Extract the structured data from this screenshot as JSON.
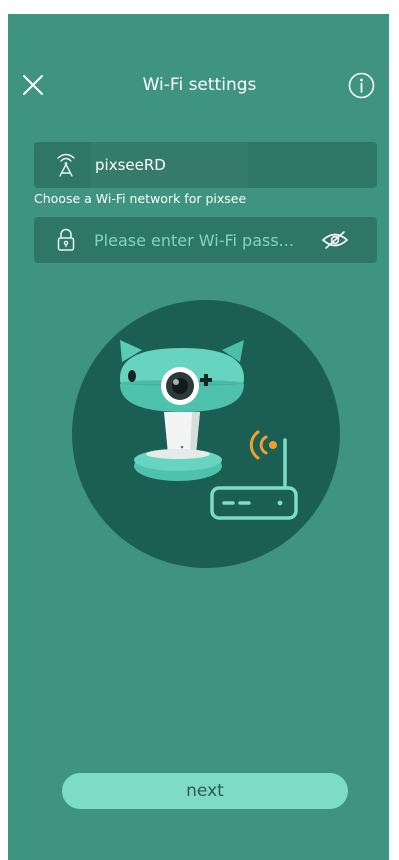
{
  "header": {
    "title": "Wi-Fi settings",
    "close_icon": "close-icon",
    "info_icon": "info-icon"
  },
  "network": {
    "ssid": "pixseeRD",
    "icon": "wifi-signal-icon",
    "hint": "Choose a Wi-Fi network for pixsee"
  },
  "password": {
    "placeholder": "Please enter Wi-Fi pass...",
    "value": "",
    "icon": "lock-icon",
    "toggle_icon": "eye-off-icon"
  },
  "illustration": {
    "camera_icon": "camera-icon",
    "router_icon": "router-icon",
    "signal_icon": "wifi-waves-icon"
  },
  "footer": {
    "next_label": "next"
  },
  "colors": {
    "background": "#3e9480",
    "field": "#2e7766",
    "circle": "#1b5f54",
    "accent": "#7ddbc8",
    "signal": "#f0a12a"
  }
}
